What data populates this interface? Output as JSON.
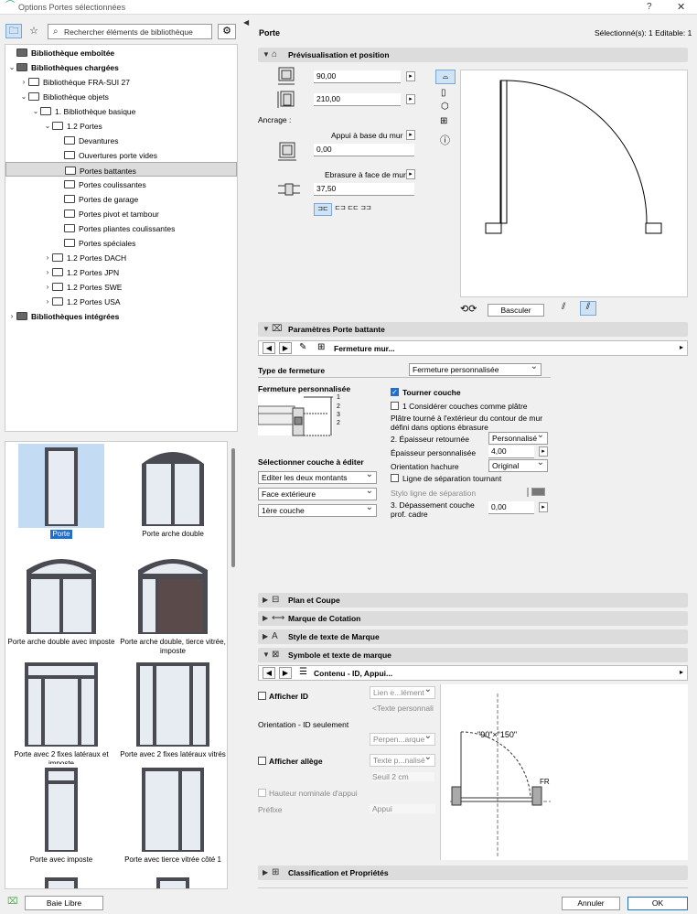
{
  "window": {
    "title": "Options Portes sélectionnées",
    "help": "?",
    "close": "✕"
  },
  "left": {
    "search_placeholder": "Rechercher éléments de bibliothèque",
    "tree": [
      {
        "label": "Bibliothèque emboîtée",
        "level": 0,
        "arrow": "",
        "bold": true,
        "folder": "dark"
      },
      {
        "label": "Bibliothèques chargées",
        "level": 0,
        "arrow": "v",
        "bold": true,
        "folder": "dark"
      },
      {
        "label": "Bibliothèque FRA-SUI 27",
        "level": 1,
        "arrow": ">",
        "bold": false,
        "folder": "light"
      },
      {
        "label": "Bibliothèque objets",
        "level": 1,
        "arrow": "v",
        "bold": false,
        "folder": "light"
      },
      {
        "label": "1. Bibliothèque basique",
        "level": 2,
        "arrow": "v",
        "bold": false,
        "folder": "light"
      },
      {
        "label": "1.2 Portes",
        "level": 3,
        "arrow": "v",
        "bold": false,
        "folder": "light"
      },
      {
        "label": "Devantures",
        "level": 4,
        "arrow": "",
        "bold": false,
        "folder": "light"
      },
      {
        "label": "Ouvertures porte vides",
        "level": 4,
        "arrow": "",
        "bold": false,
        "folder": "light"
      },
      {
        "label": "Portes battantes",
        "level": 4,
        "arrow": "",
        "bold": false,
        "folder": "light",
        "selected": true
      },
      {
        "label": "Portes coulissantes",
        "level": 4,
        "arrow": "",
        "bold": false,
        "folder": "light"
      },
      {
        "label": "Portes de garage",
        "level": 4,
        "arrow": "",
        "bold": false,
        "folder": "light"
      },
      {
        "label": "Portes pivot et tambour",
        "level": 4,
        "arrow": "",
        "bold": false,
        "folder": "light"
      },
      {
        "label": "Portes pliantes coulissantes",
        "level": 4,
        "arrow": "",
        "bold": false,
        "folder": "light"
      },
      {
        "label": "Portes spéciales",
        "level": 4,
        "arrow": "",
        "bold": false,
        "folder": "light"
      },
      {
        "label": "1.2 Portes DACH",
        "level": 3,
        "arrow": ">",
        "bold": false,
        "folder": "light"
      },
      {
        "label": "1.2 Portes JPN",
        "level": 3,
        "arrow": ">",
        "bold": false,
        "folder": "light"
      },
      {
        "label": "1.2 Portes SWE",
        "level": 3,
        "arrow": ">",
        "bold": false,
        "folder": "light"
      },
      {
        "label": "1.2 Portes USA",
        "level": 3,
        "arrow": ">",
        "bold": false,
        "folder": "light"
      },
      {
        "label": "Bibliothèques intégrées",
        "level": 0,
        "arrow": ">",
        "bold": true,
        "folder": "dark"
      }
    ],
    "gallery": [
      {
        "label": "Porte",
        "selected": true,
        "kind": "single"
      },
      {
        "label": "Porte arche double",
        "kind": "arch-double"
      },
      {
        "label": "Porte arche double avec imposte",
        "kind": "arch-double-imposte"
      },
      {
        "label": "Porte arche double, tierce vitrée, imposte",
        "kind": "arch-panel"
      },
      {
        "label": "Porte avec 2 fixes latéraux et imposte",
        "kind": "sidelights-imposte"
      },
      {
        "label": "Porte avec 2 fixes latéraux vitrés",
        "kind": "sidelights"
      },
      {
        "label": "Porte avec imposte",
        "kind": "imposte"
      },
      {
        "label": "Porte avec tierce vitrée côté 1",
        "kind": "tierce"
      }
    ],
    "footer_button": "Baie Libre"
  },
  "right": {
    "title": "Porte",
    "selection": "Sélectionné(s): 1 Editable: 1",
    "sections": {
      "preview": "Prévisualisation et position",
      "params": "Paramètres Porte battante",
      "plan": "Plan et Coupe",
      "cotation": "Marque de Cotation",
      "style": "Style de texte de Marque",
      "symbole": "Symbole et texte de marque",
      "classif": "Classification et Propriétés"
    },
    "preview": {
      "width": "90,00",
      "height": "210,00",
      "ancrage": "Ancrage :",
      "appui_label": "Appui à base du mur",
      "appui_value": "0,00",
      "ebrasure_label": "Ebrasure à face de mur",
      "ebrasure_value": "37,50",
      "basculer": "Basculer"
    },
    "params": {
      "nav_label": "Fermeture mur...",
      "type_label": "Type de fermeture",
      "type_value": "Fermeture personnalisée",
      "custom_label": "Fermeture personnalisée",
      "diagram_labels": [
        "1",
        "2",
        "3",
        "2"
      ],
      "tourner_label": "Tourner couche",
      "tourner_checked": true,
      "considerer_label": "1 Considérer couches comme plâtre",
      "platre_note": "Plâtre tourné à l'extérieur du contour de mur défini dans options ébrasure",
      "epaisseur_ret_label": "2. Épaisseur retournée",
      "epaisseur_ret_value": "Personnalisé",
      "epaisseur_pers_label": "Épaisseur personnalisée",
      "epaisseur_pers_value": "4,00",
      "orientation_label": "Orientation hachure",
      "orientation_value": "Original",
      "ligne_label": "Ligne de séparation tournant",
      "stylo_label": "Stylo ligne de séparation",
      "depassement_label": "3. Dépassement couche prof. cadre",
      "depassement_value": "0,00",
      "select_layer_label": "Sélectionner couche à éditer",
      "select1": "Editer les deux montants",
      "select2": "Face extérieure",
      "select3": "1ère couche"
    },
    "symbole": {
      "nav_label": "Contenu - ID, Appui...",
      "afficher_id": "Afficher ID",
      "lien_value": "Lien e...lément",
      "texte_perso": "<Texte personnali",
      "orientation_label": "Orientation - ID seulement",
      "orientation_value": "Perpen...arque",
      "afficher_allege": "Afficher allège",
      "texte_value": "Texte p...nalisé",
      "seuil_value": "Seuil 2 cm",
      "hauteur_label": "Hauteur nominale d'appui",
      "prefixe_label": "Préfixe",
      "prefixe_value": "Appui",
      "sym_dims": "\"90\"×\"150\"",
      "sym_fr": "FR"
    },
    "buttons": {
      "cancel": "Annuler",
      "ok": "OK"
    }
  },
  "colors": {
    "accent": "#1e6fd0",
    "section_bg": "#dcdcdc",
    "selection_bg": "#c4dcf3"
  }
}
